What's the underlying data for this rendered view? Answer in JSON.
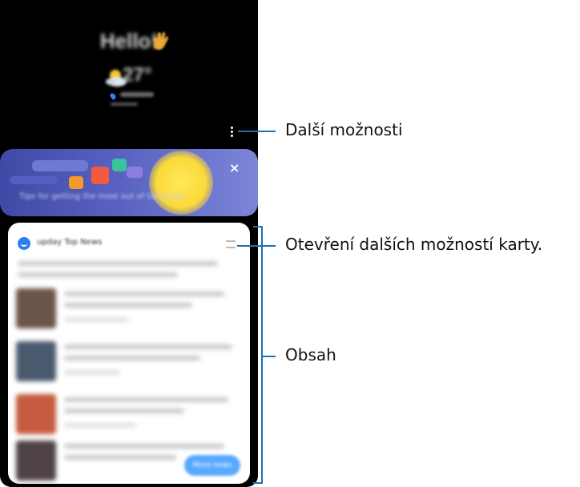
{
  "phone": {
    "greeting": "Hello!",
    "temperature": "27°",
    "tips_banner_text": "Tips for getting the most out of Samsung",
    "close_symbol": "×"
  },
  "news_card": {
    "source_title": "upday Top News",
    "more_button_label": "More news"
  },
  "callouts": {
    "more_options": "Další možnosti",
    "card_options": "Otevření dalších možností karty.",
    "content": "Obsah"
  },
  "colors": {
    "callout_line": "#1b72b6",
    "tips_card_bg": "#4b56b5",
    "more_news_button": "#59a9ff"
  }
}
